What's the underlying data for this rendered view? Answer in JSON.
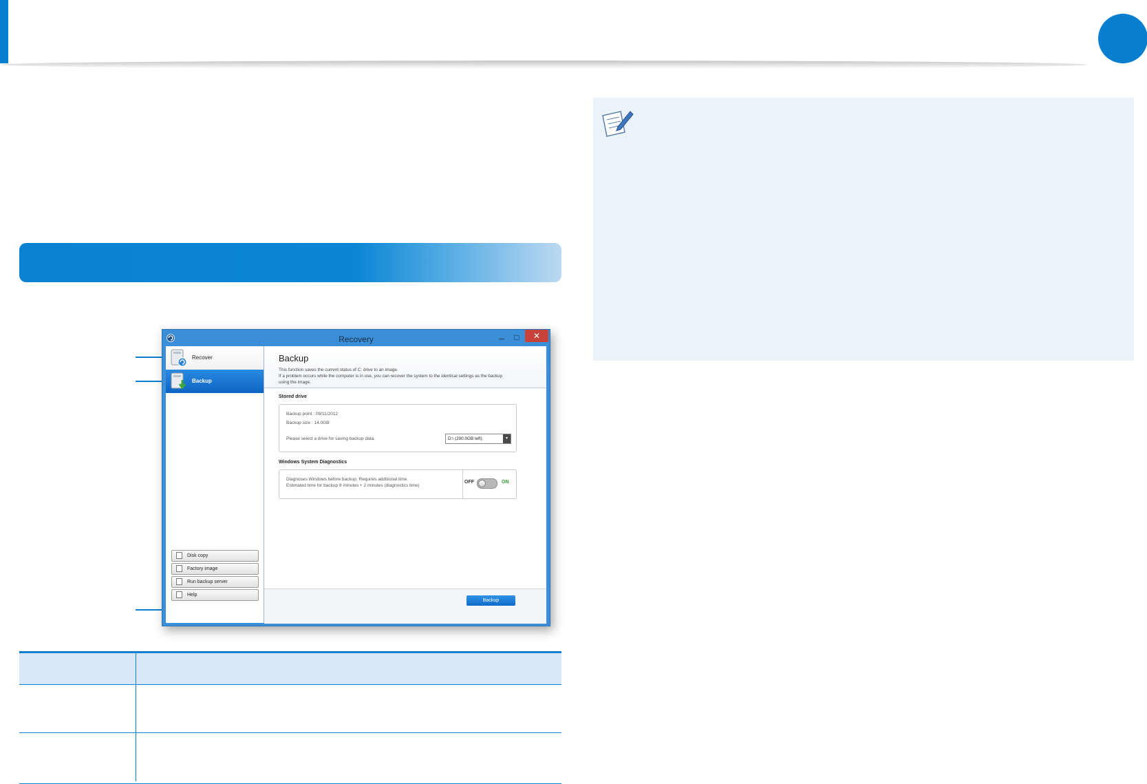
{
  "window": {
    "title": "Recovery",
    "minimize_glyph": "–",
    "maximize_glyph": "□",
    "close_glyph": "✕"
  },
  "sidebar": {
    "items": [
      {
        "label": "Recover",
        "icon": "recover-icon",
        "selected": false
      },
      {
        "label": "Backup",
        "icon": "backup-icon",
        "selected": true
      }
    ],
    "tools": [
      {
        "label": "Disk copy",
        "icon": "disk-copy-icon"
      },
      {
        "label": "Factory image",
        "icon": "factory-image-icon"
      },
      {
        "label": "Run backup server",
        "icon": "backup-server-icon"
      },
      {
        "label": "Help",
        "icon": "help-icon"
      }
    ]
  },
  "main": {
    "title": "Backup",
    "description": [
      "This function saves the current status of C: drive to an image.",
      "If a problem occurs while the computer is in use, you can recover the system to the identical settings as the backup",
      "using the image."
    ],
    "stored_drive": {
      "heading": "Stored drive",
      "backup_point": "Backup point : 09/11/2012",
      "backup_size": "Backup size : 14.0GB",
      "select_prompt": "Please select a drive for saving backup data.",
      "selected_drive": "D:\\ (200.0GB left)"
    },
    "diagnostics": {
      "heading": "Windows System Diagnostics",
      "line1": "Diagnoses Windows before backup. Requires additional time.",
      "line2": "Estimated time for backup 8 minutes + 2 minutes (diagnostics time)",
      "toggle_off_label": "OFF",
      "toggle_on_label": "ON",
      "toggle_state": "off"
    },
    "backup_button": "Backup"
  },
  "colors": {
    "accent": "#0a7fd0",
    "note_background": "#eaf2fa",
    "table_header": "#d8e8f6"
  }
}
